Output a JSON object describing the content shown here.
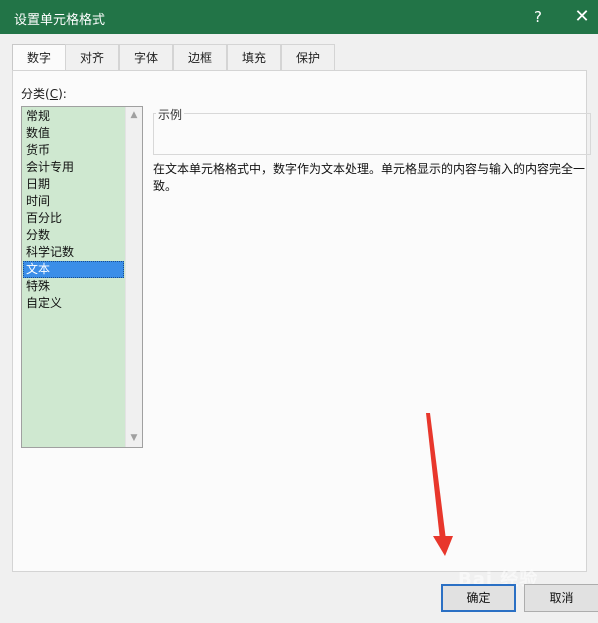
{
  "window": {
    "title": "设置单元格格式",
    "help_label": "?",
    "close_label": "✕",
    "accent": "#227447"
  },
  "tabs": [
    {
      "label": "数字",
      "active": true
    },
    {
      "label": "对齐"
    },
    {
      "label": "字体"
    },
    {
      "label": "边框"
    },
    {
      "label": "填充"
    },
    {
      "label": "保护"
    }
  ],
  "category": {
    "label_prefix": "分类(",
    "label_hotkey": "C",
    "label_suffix": "):",
    "items": [
      "常规",
      "数值",
      "货币",
      "会计专用",
      "日期",
      "时间",
      "百分比",
      "分数",
      "科学记数",
      "文本",
      "特殊",
      "自定义"
    ],
    "selected": "文本"
  },
  "sample": {
    "label": "示例"
  },
  "description": "在文本单元格格式中，数字作为文本处理。单元格显示的内容与输入的内容完全一致。",
  "buttons": {
    "ok": "确定",
    "cancel": "取消"
  },
  "watermark": "Bai 经验",
  "colors": {
    "list_bg": "#cfe8d0",
    "selection": "#3b8ee8",
    "arrow": "#e8372c"
  }
}
